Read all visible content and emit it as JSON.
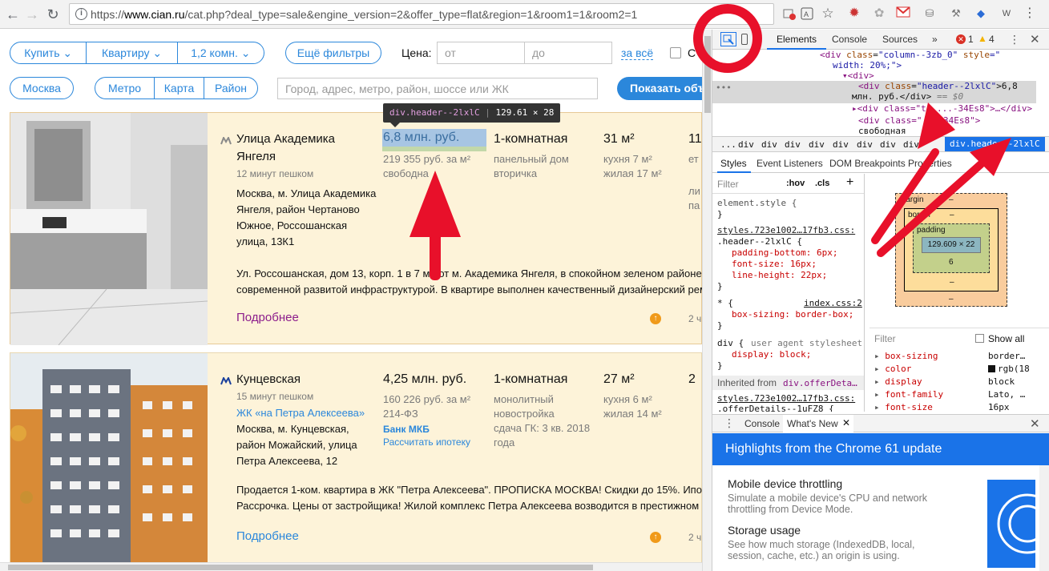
{
  "browser": {
    "url_prefix": "https://",
    "url_domain": "www.cian.ru",
    "url_path": "/cat.php?deal_type=sale&engine_version=2&offer_type=flat&region=1&room1=1&room2=1",
    "ext_labels": [
      "W"
    ]
  },
  "filters": {
    "buy": "Купить",
    "type": "Квартиру",
    "rooms": "1,2 комн.",
    "more": "Ещё фильтры",
    "price_label": "Цена:",
    "price_from": "от",
    "price_to": "до",
    "price_per": "за всё",
    "city": "Москва",
    "metro": "Метро",
    "map": "Карта",
    "district": "Район",
    "search_placeholder": "Город, адрес, метро, район, шоссе или ЖК",
    "show_button": "Показать объ"
  },
  "tooltip": {
    "selector": "div.header--2lxlC",
    "size": "129.61 × 28"
  },
  "cards": [
    {
      "metro": "Улица Академика",
      "metro2": "Янгеля",
      "walk": "12 минут пешком",
      "address": [
        "Москва, м. Улица Академика",
        "Янгеля, район Чертаново",
        "Южное, Россошанская",
        "улица, 13К1"
      ],
      "price": "6,8 млн. руб.",
      "price_m2": "219 355 руб. за м²",
      "price_note": "свободна",
      "rooms": "1-комнатная",
      "building": "панельный дом",
      "market": "вторичка",
      "area": "31 м²",
      "kitchen": "кухня 7 м²",
      "living": "жилая 17 м²",
      "floor": "11",
      "floor_extra": [
        "ет",
        "ли",
        "па"
      ],
      "desc1": "Ул. Россошанская, дом 13, корп. 1 в 7 ми     от м. Академика Янгеля, в спокойном зеленом районе",
      "desc2": "современной развитой инфраструктурой. В квартире выполнен качественный дизайнерский рем",
      "more": "Подробнее",
      "time": "2 ч"
    },
    {
      "metro": "Кунцевская",
      "walk": "15 минут пешком",
      "complex": "ЖК «на Петра Алексеева»",
      "address": [
        "Москва, м. Кунцевская,",
        "район Можайский, улица",
        "Петра Алексеева, 12"
      ],
      "price": "4,25 млн. руб.",
      "price_m2": "160 226 руб. за м²",
      "law": "214-ФЗ",
      "bank": "Банк МКБ",
      "mortgage": "Рассчитать ипотеку",
      "rooms": "1-комнатная",
      "building": "монолитный",
      "market": "новостройка",
      "delivery": "сдача ГК: 3 кв. 2018",
      "delivery2": "года",
      "area": "27 м²",
      "kitchen": "кухня 6 м²",
      "living": "жилая 14 м²",
      "floor": "2",
      "desc1": "Продается 1-ком. квартира в ЖК \"Петра Алексеева\". ПРОПИСКА МОСКВА! Скидки до 15%. Ипо",
      "desc2": "Рассрочка. Цены от застройщика! Жилой комплекс Петра Алексеева возводится в престижном",
      "more": "Подробнее",
      "time": "2 ч"
    }
  ],
  "devtools": {
    "tabs": [
      "Elements",
      "Console",
      "Sources",
      "»"
    ],
    "errors": "1",
    "warnings": "4",
    "dom": {
      "l1_a": "<div ",
      "l1_attr": "class",
      "l1_val": "\"column--3zb_0\"",
      "l1_attr2": " style",
      "l1_val2": "=\"",
      "l1_b": "width: 20%;\">",
      "l2": "▾<div>",
      "l3_a": "<div ",
      "l3_attr": "class",
      "l3_val": "\"header--2lxlC\"",
      "l3_text": ">6,8",
      "l4": "млн. руб.</div>",
      "l4_b": " == $0",
      "l5": "▸<div class=\"te ...-34Es8\">…</div>",
      "l6": "<div class=\"...-34Es8\">",
      "l7": "свободная"
    },
    "breadcrumbs": [
      "...",
      "div",
      "div",
      "div",
      "div",
      "div",
      "div",
      "div",
      "div",
      "div.header--2lxlC"
    ],
    "styles_tabs": [
      "Styles",
      "Event Listeners",
      "DOM Breakpoints",
      "Properties"
    ],
    "filter": "Filter",
    "hov": ":hov",
    "cls": ".cls",
    "rules": {
      "element_style": "element.style {",
      "close": "}",
      "source1": "styles.723e1002…17fb3.css:",
      "selector1": ".header--2lxlC {",
      "p1": "padding-bottom: 6px;",
      "p2": "font-size: 16px;",
      "p3": "line-height: 22px;",
      "selector2": "* {",
      "source2": "index.css:2",
      "p4": "box-sizing: border-box;",
      "selector3": "div {",
      "ua": "user agent stylesheet",
      "p5": "display: block;",
      "inherited": "Inherited from",
      "inherited_el": "div.offerDeta…",
      "source3": "styles.723e1002…17fb3.css:",
      "selector4": ".offerDetails--1uFZ8 {"
    },
    "boxmodel": {
      "margin": "margin",
      "border": "border",
      "padding": "padding",
      "content": "129.609 × 22",
      "dash": "–",
      "padding_bottom": "6"
    },
    "computed": {
      "filter": "Filter",
      "show_all": "Show all",
      "rows": [
        {
          "name": "box-sizing",
          "value": "border…"
        },
        {
          "name": "color",
          "value": "rgb(18"
        },
        {
          "name": "display",
          "value": "block"
        },
        {
          "name": "font-family",
          "value": "Lato, …"
        },
        {
          "name": "font-size",
          "value": "16px"
        }
      ]
    },
    "drawer_tabs": [
      "Console",
      "What's New"
    ],
    "drawer_title": "Highlights from the Chrome 61 update",
    "news": [
      {
        "title": "Mobile device throttling",
        "text1": "Simulate a mobile device's CPU and network",
        "text2": "throttling from Device Mode."
      },
      {
        "title": "Storage usage",
        "text1": "See how much storage (IndexedDB, local,",
        "text2": "session, cache, etc.) an origin is using."
      }
    ]
  },
  "colors": {
    "accent": "#2b87db",
    "card_bg": "#fdf3d9",
    "devtools_blue": "#1a73e8",
    "annotation_red": "#e8102a"
  }
}
